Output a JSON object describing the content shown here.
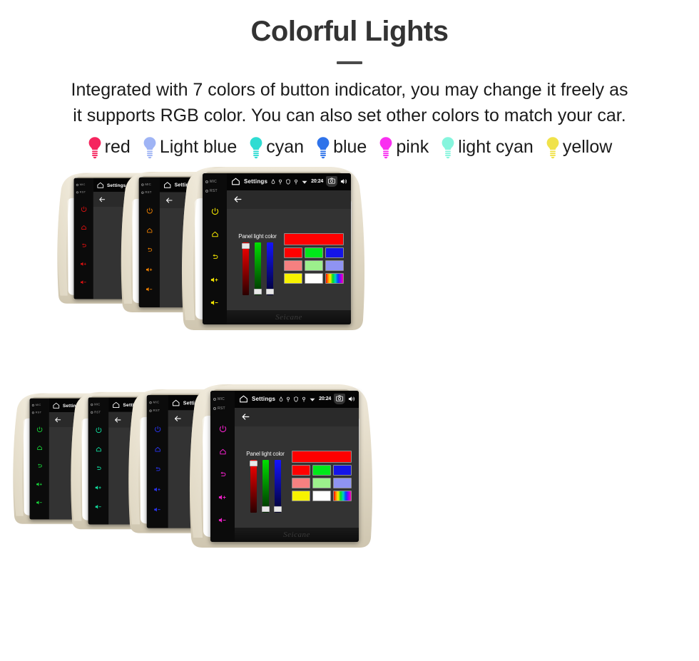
{
  "header": {
    "title": "Colorful Lights",
    "body_line1": "Integrated with 7 colors of button indicator, you may change it freely as",
    "body_line2": "it supports RGB color. You can also set other colors to match your car."
  },
  "legend": {
    "items": [
      {
        "label": "red",
        "color": "#f5255e",
        "icon": "bulb-icon"
      },
      {
        "label": "Light blue",
        "color": "#9fb4f5",
        "icon": "bulb-icon"
      },
      {
        "label": "cyan",
        "color": "#2fdcd2",
        "icon": "bulb-icon"
      },
      {
        "label": "blue",
        "color": "#2f73ea",
        "icon": "bulb-icon"
      },
      {
        "label": "pink",
        "color": "#f92ff0",
        "icon": "bulb-icon"
      },
      {
        "label": "light cyan",
        "color": "#86f5dd",
        "icon": "bulb-icon"
      },
      {
        "label": "yellow",
        "color": "#f0e24a",
        "icon": "bulb-icon"
      }
    ]
  },
  "unit_ui": {
    "statusbar": {
      "title": "Settings",
      "clock": "20:24",
      "home_icon": "home-icon",
      "left_icons": [
        "location-icon",
        "key-icon"
      ],
      "right_icons": [
        "shield-icon",
        "location-icon",
        "wifi-icon"
      ],
      "camera_icon": "camera-icon",
      "volume_icon": "speaker-icon",
      "close_icon": "close-box-icon",
      "recents_icon": "recents-icon",
      "back_icon": "back-arrow-icon"
    },
    "appbar": {
      "back_icon": "back-arrow-icon"
    },
    "panel": {
      "caption": "Panel light color",
      "sliders": [
        {
          "name": "red",
          "value": 100,
          "gradient_top": "#ff0000",
          "thumb_position": "top"
        },
        {
          "name": "green",
          "value": 0,
          "gradient_top": "#00e000",
          "thumb_position": "bottom"
        },
        {
          "name": "blue",
          "value": 0,
          "gradient_top": "#1414ff",
          "thumb_position": "bottom"
        }
      ],
      "preview_color": "#ff0000",
      "swatch_rows": [
        [
          "#ff0000",
          "#00e81a",
          "#1414e8"
        ],
        [
          "#f58080",
          "#9cf08c",
          "#8f93f2"
        ],
        [
          "#f7f200",
          "#ffffff",
          "rainbow"
        ]
      ]
    },
    "sidekeys": {
      "mic_label": "MIC",
      "rst_label": "RST",
      "buttons": [
        "power-icon",
        "home-icon",
        "back-icon",
        "volume-up-icon",
        "volume-down-icon"
      ]
    },
    "brand": "Seicane"
  },
  "groups": [
    {
      "name": "top-group",
      "units": [
        {
          "key_color": "#e01010",
          "front": false
        },
        {
          "key_color": "#ef8000",
          "front": false
        },
        {
          "key_color": "#f2e400",
          "front": true
        }
      ]
    },
    {
      "name": "bottom-group",
      "units": [
        {
          "key_color": "#18d83a",
          "front": false
        },
        {
          "key_color": "#10e0a0",
          "front": false
        },
        {
          "key_color": "#2a36f5",
          "front": false
        },
        {
          "key_color": "#ee20c8",
          "front": true
        }
      ]
    }
  ]
}
